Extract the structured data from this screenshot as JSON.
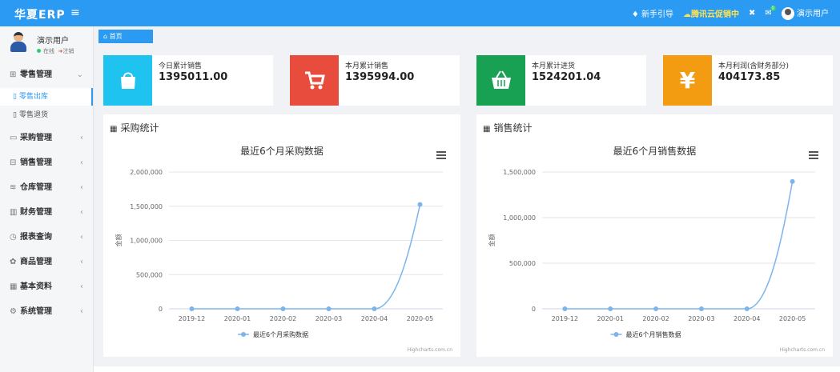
{
  "app": {
    "logo": "华夏ERP",
    "menu_toggle": "≡"
  },
  "topbar": {
    "guide": "新手引导",
    "promo": "腾讯云促销中",
    "mail_badge": "0",
    "user": "演示用户"
  },
  "user_panel": {
    "name": "演示用户",
    "online": "在线",
    "logout": "注销"
  },
  "sidebar": {
    "items": [
      {
        "label": "零售管理",
        "icon": "gift-icon",
        "expanded": true
      },
      {
        "label": "采购管理",
        "icon": "cart-icon"
      },
      {
        "label": "销售管理",
        "icon": "briefcase-icon"
      },
      {
        "label": "仓库管理",
        "icon": "layers-icon"
      },
      {
        "label": "财务管理",
        "icon": "book-icon"
      },
      {
        "label": "报表查询",
        "icon": "clock-icon"
      },
      {
        "label": "商品管理",
        "icon": "flower-icon"
      },
      {
        "label": "基本资料",
        "icon": "grid-icon"
      },
      {
        "label": "系统管理",
        "icon": "gear-icon"
      }
    ],
    "subitems": [
      {
        "label": "零售出库",
        "active": true
      },
      {
        "label": "零售退货",
        "active": false
      }
    ]
  },
  "tabs": [
    {
      "label": "首页",
      "icon": "home-icon"
    }
  ],
  "stats": [
    {
      "label": "今日累计销售",
      "value": "1395011.00",
      "color": "#1ec3f0",
      "icon": "shopping-bag-icon"
    },
    {
      "label": "本月累计销售",
      "value": "1395994.00",
      "color": "#e74c3c",
      "icon": "cart-icon"
    },
    {
      "label": "本月累计进货",
      "value": "1524201.04",
      "color": "#18a152",
      "icon": "basket-icon"
    },
    {
      "label": "本月利润(含财务部分)",
      "value": "404173.85",
      "color": "#f39c12",
      "icon": "yen-icon"
    }
  ],
  "panels": {
    "purchase_title": "采购统计",
    "sales_title": "销售统计"
  },
  "chart_data": [
    {
      "type": "line",
      "title": "最近6个月采购数据",
      "categories": [
        "2019-12",
        "2020-01",
        "2020-02",
        "2020-03",
        "2020-04",
        "2020-05"
      ],
      "series": [
        {
          "name": "最近6个月采购数据",
          "values": [
            0,
            0,
            0,
            0,
            0,
            1524201
          ]
        }
      ],
      "ylabel": "金额",
      "ylim": [
        0,
        2000000
      ],
      "yticks": [
        "0",
        "500,000",
        "1,000,000",
        "1,500,000",
        "2,000,000"
      ],
      "credit": "Highcharts.com.cn",
      "color": "#7cb5ec"
    },
    {
      "type": "line",
      "title": "最近6个月销售数据",
      "categories": [
        "2019-12",
        "2020-01",
        "2020-02",
        "2020-03",
        "2020-04",
        "2020-05"
      ],
      "series": [
        {
          "name": "最近6个月销售数据",
          "values": [
            0,
            0,
            0,
            0,
            0,
            1395994
          ]
        }
      ],
      "ylabel": "金额",
      "ylim": [
        0,
        1500000
      ],
      "yticks": [
        "0",
        "500,000",
        "1,000,000",
        "1,500,000"
      ],
      "credit": "Highcharts.com.cn",
      "color": "#7cb5ec"
    }
  ]
}
